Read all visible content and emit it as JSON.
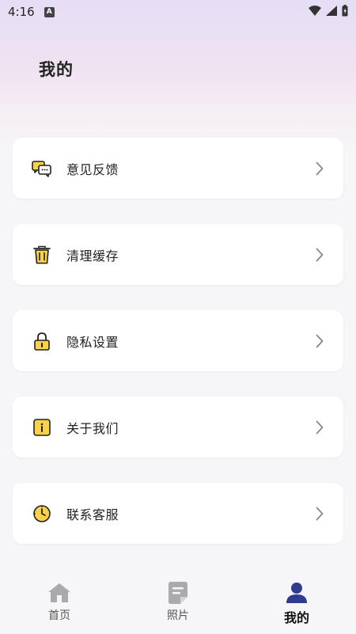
{
  "status": {
    "time": "4:16",
    "badge": "A"
  },
  "header": {
    "title": "我的"
  },
  "menu": [
    {
      "label": "意见反馈",
      "icon": "feedback-chat-icon"
    },
    {
      "label": "清理缓存",
      "icon": "trash-icon"
    },
    {
      "label": "隐私设置",
      "icon": "lock-icon"
    },
    {
      "label": "关于我们",
      "icon": "info-icon"
    },
    {
      "label": "联系客服",
      "icon": "clock-icon"
    }
  ],
  "tabs": [
    {
      "label": "首页",
      "icon": "home-icon",
      "active": false
    },
    {
      "label": "照片",
      "icon": "photo-doc-icon",
      "active": false
    },
    {
      "label": "我的",
      "icon": "user-icon",
      "active": true
    }
  ],
  "colors": {
    "accent": "#2f3b8f",
    "iconYellow": "#f7d24a",
    "inactive": "#a9a9ae"
  }
}
